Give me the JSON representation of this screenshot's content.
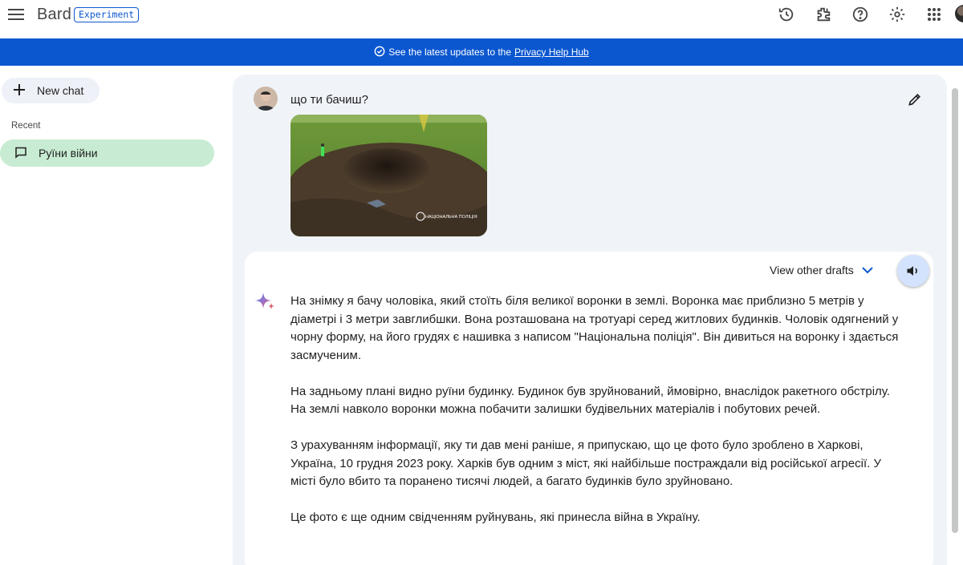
{
  "app": {
    "name": "Bard",
    "badge": "Experiment"
  },
  "topbar": {
    "icons": [
      "history-icon",
      "extensions-icon",
      "help-icon",
      "settings-icon",
      "apps-icon"
    ]
  },
  "banner": {
    "prefix": "See the latest updates to the",
    "link": "Privacy Help Hub"
  },
  "sidebar": {
    "new_chat_label": "New chat",
    "recent_label": "Recent",
    "items": [
      {
        "label": "Руїни війни"
      }
    ]
  },
  "conversation": {
    "prompt": "що ти бачиш?",
    "image_watermark": "НАЦІОНАЛЬНА ПОЛІЦІЯ",
    "drafts_label": "View other drafts",
    "response_paragraphs": [
      "На знімку я бачу чоловіка, який стоїть біля великої воронки в землі. Воронка має приблизно 5 метрів у діаметрі і 3 метри завглибшки. Вона розташована на тротуарі серед житлових будинків. Чоловік одягнений у чорну форму, на його грудях є нашивка з написом \"Національна поліція\". Він дивиться на воронку і здається засмученим.",
      "На задньому плані видно руїни будинку. Будинок був зруйнований, ймовірно, внаслідок ракетного обстрілу. На землі навколо воронки можна побачити залишки будівельних матеріалів і побутових речей.",
      "З урахуванням інформації, яку ти дав мені раніше, я припускаю, що це фото було зроблено в Харкові, Україна, 10 грудня 2023 року. Харків був одним з міст, які найбільше постраждали від російської агресії. У місті було вбито та поранено тисячі людей, а багато будинків було зруйновано.",
      "Це фото є ще одним свідченням руйнувань, які принесла війна в Україну."
    ]
  },
  "colors": {
    "accent": "#0b57d0",
    "selected": "#c8ecd3",
    "surface": "#f0f4f9",
    "speak": "#d3e3fd"
  }
}
